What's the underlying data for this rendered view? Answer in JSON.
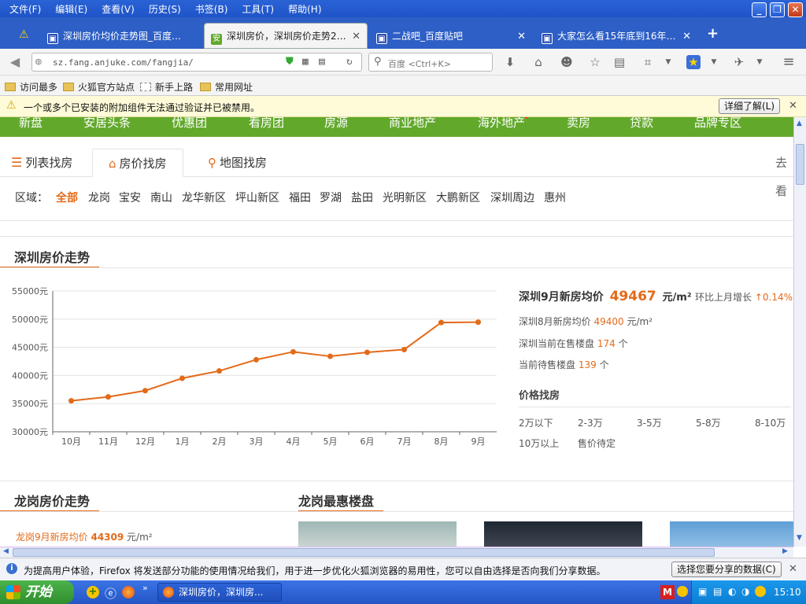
{
  "menubar": {
    "items": [
      "文件(F)",
      "编辑(E)",
      "查看(V)",
      "历史(S)",
      "书签(B)",
      "工具(T)",
      "帮助(H)"
    ]
  },
  "tabs": [
    {
      "label": "深圳房价均价走势图_百度…"
    },
    {
      "label": "深圳房价，深圳房价走势2…"
    },
    {
      "label": "二战吧_百度贴吧"
    },
    {
      "label": "大家怎么看15年底到16年…"
    }
  ],
  "navbar": {
    "url": "sz.fang.anjuke.com/fangjia/",
    "search_placeholder": "百度 <Ctrl+K>"
  },
  "bookmarks": [
    "访问最多",
    "火狐官方站点",
    "新手上路",
    "常用网址"
  ],
  "notice": {
    "text": "一个或多个已安装的附加组件无法通过验证并已被禁用。",
    "button": "详细了解(L)"
  },
  "site": {
    "nav": [
      "新盘",
      "安居头条",
      "优惠团",
      "看房团",
      "房源",
      "商业地产",
      "海外地产",
      "卖房",
      "贷款",
      "品牌专区"
    ],
    "view_tabs": [
      "列表找房",
      "房价找房",
      "地图找房"
    ],
    "right_link": "去看",
    "region_label": "区域：",
    "regions": [
      "全部",
      "龙岗",
      "宝安",
      "南山",
      "龙华新区",
      "坪山新区",
      "福田",
      "罗湖",
      "盐田",
      "光明新区",
      "大鹏新区",
      "深圳周边",
      "惠州"
    ]
  },
  "trend": {
    "title": "深圳房价走势",
    "headline_prefix": "深圳9月新房均价",
    "headline_value": "49467",
    "headline_unit": "元/m²",
    "mom_label": "环比上月增长",
    "mom_value": "↑0.14%",
    "aug_label": "深圳8月新房均价",
    "aug_value": "49400",
    "aug_unit": "元/m²",
    "onsale_label": "深圳当前在售楼盘",
    "onsale_value": "174",
    "onsale_unit": "个",
    "pending_label": "当前待售楼盘",
    "pending_value": "139",
    "pending_unit": "个",
    "price_title": "价格找房",
    "price_filters": [
      "2万以下",
      "2-3万",
      "3-5万",
      "5-8万",
      "8-10万",
      "10万以上",
      "售价待定"
    ]
  },
  "chart_data": {
    "type": "line",
    "x": [
      "10月",
      "11月",
      "12月",
      "1月",
      "2月",
      "3月",
      "4月",
      "5月",
      "6月",
      "7月",
      "8月",
      "9月"
    ],
    "series": [
      {
        "values": [
          35500,
          36200,
          37300,
          39500,
          40800,
          42800,
          44200,
          43400,
          44100,
          44600,
          49400,
          49467
        ]
      }
    ],
    "ylim": [
      30000,
      55000
    ],
    "yticks": [
      "30000元",
      "35000元",
      "40000元",
      "45000元",
      "50000元",
      "55000元"
    ],
    "grid": true,
    "color": "#e36a19"
  },
  "longgang": {
    "title": "龙岗房价走势",
    "listing_title": "龙岗最惠楼盘",
    "price_label": "龙岗9月新房均价",
    "price_value": "44309",
    "price_unit": "元/m²"
  },
  "statusbar": {
    "text": "为提高用户体验，Firefox 将发送部分功能的使用情况给我们，用于进一步优化火狐浏览器的易用性，您可以自由选择是否向我们分享数据。",
    "button": "选择您要分享的数据(C)"
  },
  "taskbar": {
    "start": "开始",
    "task": "深圳房价，深圳房...",
    "clock": "15:10"
  }
}
